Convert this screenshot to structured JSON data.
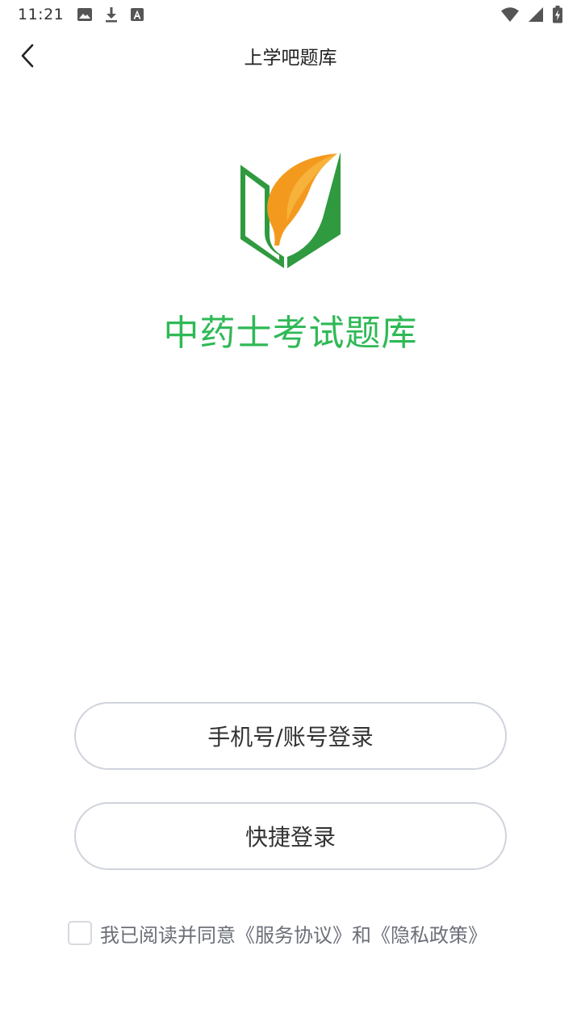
{
  "status_bar": {
    "time": "11:21",
    "left_icons": [
      "image-icon",
      "download-icon",
      "font-a-icon"
    ],
    "right_icons": [
      "wifi-icon",
      "cell-signal-icon",
      "battery-charging-icon"
    ]
  },
  "nav": {
    "back_icon": "chevron-left-icon",
    "title": "上学吧题库"
  },
  "brand": {
    "logo_icon": "book-leaf-logo",
    "app_name": "中药士考试题库",
    "color_green": "#2fb956",
    "color_orange": "#f39a1e"
  },
  "buttons": {
    "phone_login": "手机号/账号登录",
    "quick_login": "快捷登录"
  },
  "agreement": {
    "prefix": "我已阅读并同意",
    "service_link": "《服务协议》",
    "and": "和",
    "privacy_link": "《隐私政策》",
    "checked": false
  }
}
